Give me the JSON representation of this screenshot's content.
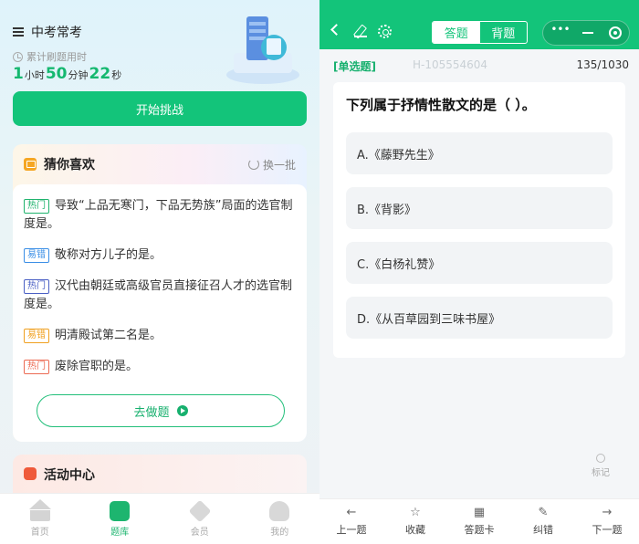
{
  "left": {
    "header_title": "中考常考",
    "timer_label": "累计刷题用时",
    "timer": {
      "hours": "1",
      "h_unit": "小时",
      "minutes": "50",
      "m_unit": "分钟",
      "seconds": "22",
      "s_unit": "秒"
    },
    "start_button": "开始挑战",
    "recommend": {
      "title": "猜你喜欢",
      "refresh_label": "换一批",
      "items": [
        {
          "tag": "热门",
          "text": "导致“上品无寒门，下品无势族”局面的选官制度是。"
        },
        {
          "tag": "易错",
          "text": "敬称对方儿子的是。"
        },
        {
          "tag": "热门",
          "text": "汉代由朝廷或高级官员直接征召人才的选官制度是。"
        },
        {
          "tag": "易错",
          "text": "明清殿试第二名是。"
        },
        {
          "tag": "热门",
          "text": "废除官职的是。"
        }
      ],
      "go_button": "去做题"
    },
    "activity_title": "活动中心",
    "tabbar": [
      {
        "label": "首页",
        "icon": "home-icon"
      },
      {
        "label": "题库",
        "icon": "question-bank-icon"
      },
      {
        "label": "会员",
        "icon": "vip-icon"
      },
      {
        "label": "我的",
        "icon": "user-icon"
      }
    ]
  },
  "right": {
    "mode_tabs": {
      "answer": "答题",
      "recite": "背题"
    },
    "question_type": "[单选题]",
    "question_id": "H-105554604",
    "progress": "135/1030",
    "question": "下列属于抒情性散文的是（ ）。",
    "options": [
      "A.《藤野先生》",
      "B.《背影》",
      "C.《白杨礼赞》",
      "D.《从百草园到三味书屋》"
    ],
    "mark_label": "标记",
    "bottom_bar": [
      {
        "label": "上一题",
        "icon": "arrow-left-icon"
      },
      {
        "label": "收藏",
        "icon": "star-icon"
      },
      {
        "label": "答题卡",
        "icon": "grid-icon"
      },
      {
        "label": "纠错",
        "icon": "edit-icon"
      },
      {
        "label": "下一题",
        "icon": "arrow-right-icon"
      }
    ]
  },
  "colors": {
    "brand_green": "#13c47a",
    "orange": "#f5a623",
    "red": "#ef5a3a"
  }
}
